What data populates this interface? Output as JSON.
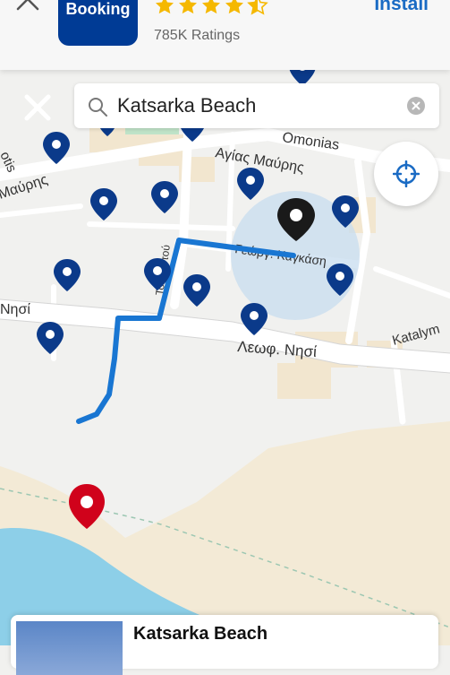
{
  "banner": {
    "app_name": "Booking",
    "star_rating": 4.5,
    "ratings_text": "785K Ratings",
    "install_label": "Install",
    "brand_color": "#003b95",
    "star_color": "#f5b800",
    "install_color": "#1a6bc4"
  },
  "search": {
    "query": "Katsarka Beach"
  },
  "map": {
    "street_labels": {
      "omonias": "Omonias",
      "agias_mavris": "Αγίας Μαύρης",
      "mavris_left": "Μαύρης",
      "otis": "otis",
      "georgiou": "Γεώργ. Καγκάση",
      "leof_nisi": "Λεωφ. Νησί",
      "nisi_left": "Νησί",
      "katalym": "Katalym",
      "vertical_road": "Τσαλαντού"
    },
    "route_color": "#1976d2",
    "pin_color": "#0b3a8a",
    "selected_pin_color": "#1a1a1a",
    "destination_pin_color": "#d0021b",
    "sea_color": "#8dcfe8",
    "sand_color": "#f3ead6"
  },
  "card": {
    "title": "Katsarka Beach"
  }
}
